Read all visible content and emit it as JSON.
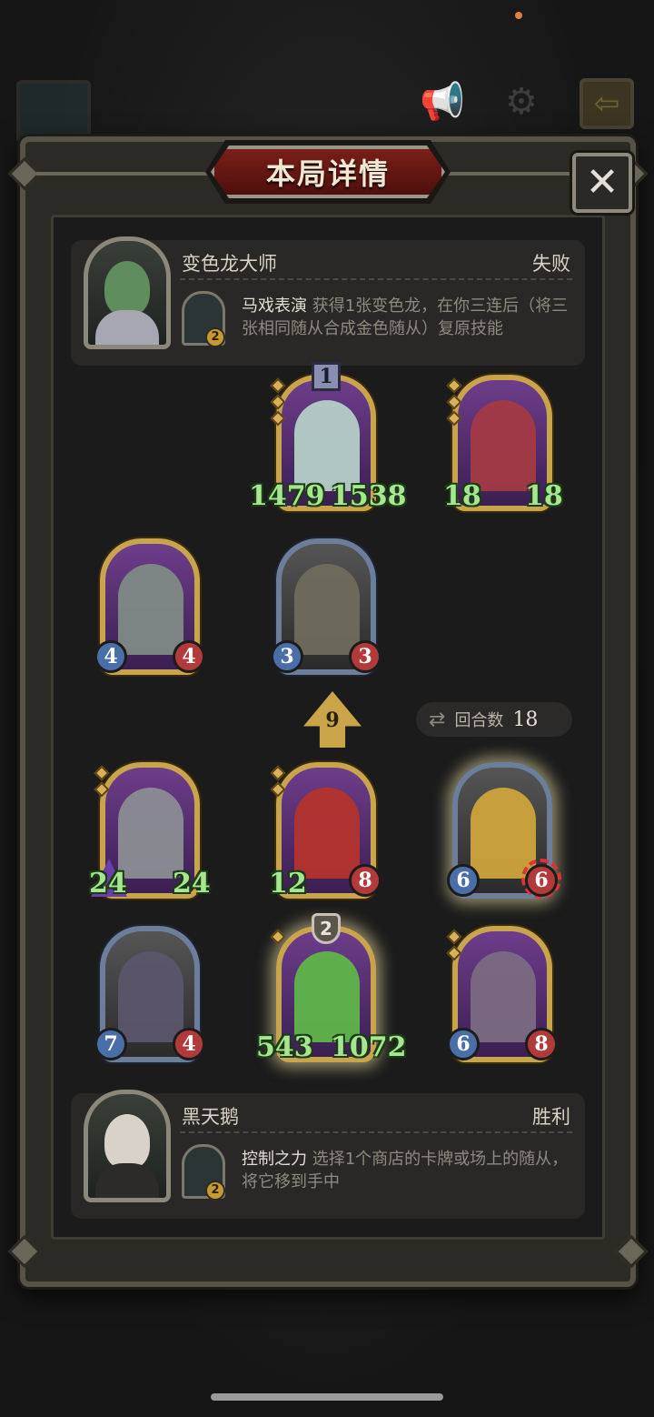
{
  "window": {
    "title": "本局详情",
    "close_symbol": "✕"
  },
  "opponent": {
    "name": "变色龙大师",
    "result": "失败",
    "skill_level": "2",
    "skill_name": "马戏表演",
    "skill_text": "获得1张变色龙，在你三连后（将三张相同随从合成金色随从）复原技能"
  },
  "player": {
    "name": "黑天鹅",
    "result": "胜利",
    "skill_level": "2",
    "skill_name": "控制之力",
    "skill_text": "选择1个商店的卡牌或场上的随从，将它移到手中"
  },
  "round": {
    "label": "回合数",
    "value": "18"
  },
  "tier_arrow": "9",
  "opponent_board": [
    {
      "attack": "1479",
      "health": "1538",
      "badge": "1",
      "frame": "gold"
    },
    {
      "attack": "18",
      "health": "18",
      "frame": "gold"
    },
    {
      "attack": "4",
      "health": "4",
      "frame": "gold"
    },
    {
      "attack": "3",
      "health": "3",
      "frame": "blue"
    }
  ],
  "player_board": [
    {
      "attack": "24",
      "health": "24",
      "frame": "gold"
    },
    {
      "attack": "12",
      "health": "8",
      "frame": "gold"
    },
    {
      "attack": "6",
      "health": "6",
      "frame": "blue"
    },
    {
      "attack": "7",
      "health": "4",
      "frame": "blue"
    },
    {
      "attack": "543",
      "health": "1072",
      "badge": "2",
      "frame": "gold"
    },
    {
      "attack": "6",
      "health": "8",
      "frame": "gold"
    }
  ],
  "colors": {
    "gold_frame": "#c8a44c",
    "blue_frame": "#6d7e9a",
    "stat_green": "#a6e690",
    "title_red": "#7a1f19"
  },
  "icons": [
    "megaphone-icon",
    "gear-icon",
    "exit-icon",
    "close-icon",
    "swap-arrows-icon"
  ]
}
